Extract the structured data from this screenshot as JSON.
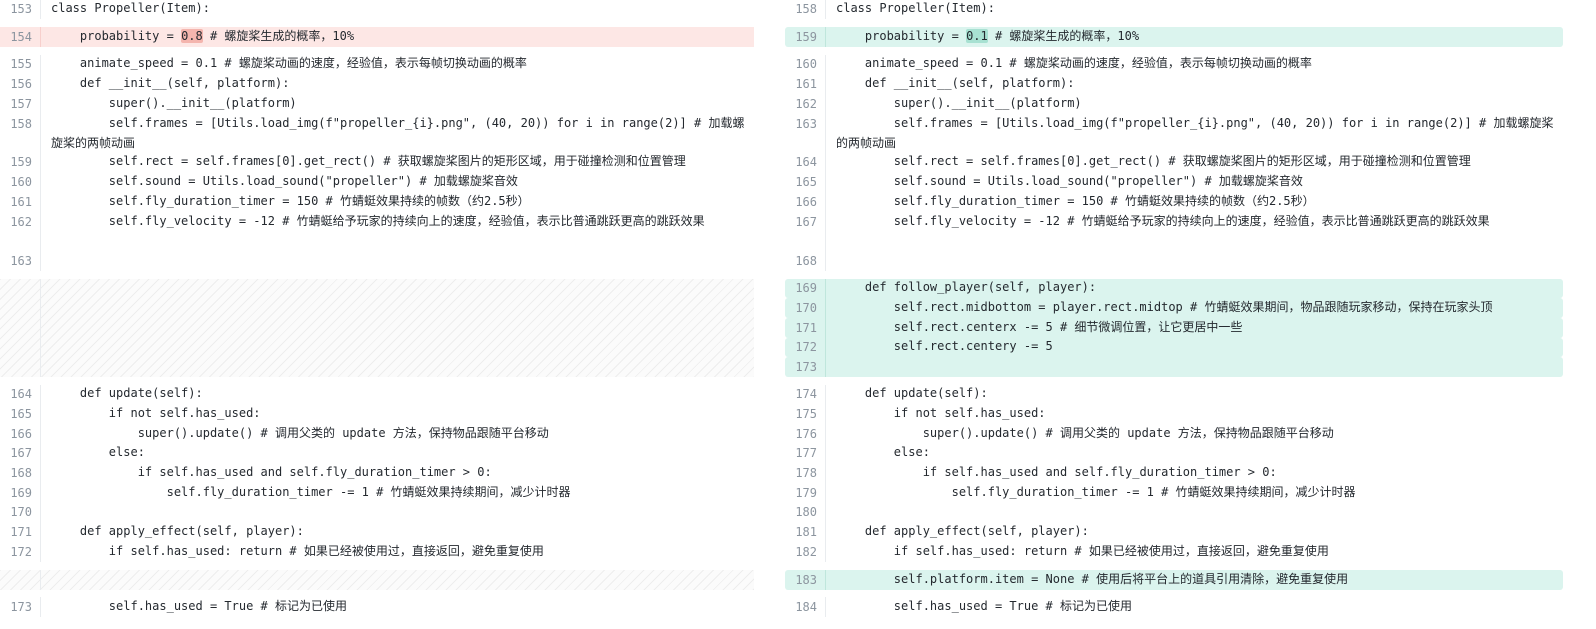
{
  "left": {
    "rows": [
      {
        "num": "153",
        "text": "class Propeller(Item):"
      },
      {
        "num": "154",
        "pre": "    probability = ",
        "mark": "0.8",
        "post": " # 螺旋桨生成的概率，10%"
      },
      {
        "num": "155",
        "text": "    animate_speed = 0.1 # 螺旋桨动画的速度，经验值，表示每帧切换动画的概率"
      },
      {
        "num": "156",
        "text": "    def __init__(self, platform):"
      },
      {
        "num": "157",
        "text": "        super().__init__(platform)"
      },
      {
        "num": "158",
        "text": "        self.frames = [Utils.load_img(f\"propeller_{i}.png\", (40, 20)) for i in range(2)] # 加载螺旋桨的两帧动画"
      },
      {
        "num": "159",
        "text": "        self.rect = self.frames[0].get_rect() # 获取螺旋桨图片的矩形区域，用于碰撞检测和位置管理"
      },
      {
        "num": "160",
        "text": "        self.sound = Utils.load_sound(\"propeller\") # 加载螺旋桨音效"
      },
      {
        "num": "161",
        "text": "        self.fly_duration_timer = 150 # 竹蜻蜓效果持续的帧数（约2.5秒）"
      },
      {
        "num": "162",
        "text": "        self.fly_velocity = -12 # 竹蜻蜓给予玩家的持续向上的速度，经验值，表示比普通跳跃更高的跳跃效果"
      },
      {
        "num": "163",
        "text": ""
      },
      {
        "num": "164",
        "text": "    def update(self):"
      },
      {
        "num": "165",
        "text": "        if not self.has_used:"
      },
      {
        "num": "166",
        "text": "            super().update() # 调用父类的 update 方法，保持物品跟随平台移动"
      },
      {
        "num": "167",
        "text": "        else:"
      },
      {
        "num": "168",
        "text": "            if self.has_used and self.fly_duration_timer > 0:"
      },
      {
        "num": "169",
        "text": "                self.fly_duration_timer -= 1 # 竹蜻蜓效果持续期间，减少计时器"
      },
      {
        "num": "170",
        "text": ""
      },
      {
        "num": "171",
        "text": "    def apply_effect(self, player):"
      },
      {
        "num": "172",
        "text": "        if self.has_used: return # 如果已经被使用过，直接返回，避免重复使用"
      },
      {
        "num": "173",
        "text": "        self.has_used = True # 标记为已使用"
      }
    ]
  },
  "right": {
    "rows": [
      {
        "num": "158",
        "text": "class Propeller(Item):"
      },
      {
        "num": "159",
        "pre": "    probability = ",
        "mark": "0.1",
        "post": " # 螺旋桨生成的概率，10%"
      },
      {
        "num": "160",
        "text": "    animate_speed = 0.1 # 螺旋桨动画的速度，经验值，表示每帧切换动画的概率"
      },
      {
        "num": "161",
        "text": "    def __init__(self, platform):"
      },
      {
        "num": "162",
        "text": "        super().__init__(platform)"
      },
      {
        "num": "163",
        "text": "        self.frames = [Utils.load_img(f\"propeller_{i}.png\", (40, 20)) for i in range(2)] # 加载螺旋桨的两帧动画"
      },
      {
        "num": "164",
        "text": "        self.rect = self.frames[0].get_rect() # 获取螺旋桨图片的矩形区域，用于碰撞检测和位置管理"
      },
      {
        "num": "165",
        "text": "        self.sound = Utils.load_sound(\"propeller\") # 加载螺旋桨音效"
      },
      {
        "num": "166",
        "text": "        self.fly_duration_timer = 150 # 竹蜻蜓效果持续的帧数（约2.5秒）"
      },
      {
        "num": "167",
        "text": "        self.fly_velocity = -12 # 竹蜻蜓给予玩家的持续向上的速度，经验值，表示比普通跳跃更高的跳跃效果"
      },
      {
        "num": "168",
        "text": ""
      },
      {
        "num": "169",
        "text": "    def follow_player(self, player):"
      },
      {
        "num": "170",
        "text": "        self.rect.midbottom = player.rect.midtop # 竹蜻蜓效果期间，物品跟随玩家移动，保持在玩家头顶"
      },
      {
        "num": "171",
        "text": "        self.rect.centerx -= 5 # 细节微调位置，让它更居中一些"
      },
      {
        "num": "172",
        "text": "        self.rect.centery -= 5"
      },
      {
        "num": "173",
        "text": ""
      },
      {
        "num": "174",
        "text": "    def update(self):"
      },
      {
        "num": "175",
        "text": "        if not self.has_used:"
      },
      {
        "num": "176",
        "text": "            super().update() # 调用父类的 update 方法，保持物品跟随平台移动"
      },
      {
        "num": "177",
        "text": "        else:"
      },
      {
        "num": "178",
        "text": "            if self.has_used and self.fly_duration_timer > 0:"
      },
      {
        "num": "179",
        "text": "                self.fly_duration_timer -= 1 # 竹蜻蜓效果持续期间，减少计时器"
      },
      {
        "num": "180",
        "text": ""
      },
      {
        "num": "181",
        "text": "    def apply_effect(self, player):"
      },
      {
        "num": "182",
        "text": "        if self.has_used: return # 如果已经被使用过，直接返回，避免重复使用"
      },
      {
        "num": "183",
        "text": "        self.platform.item = None # 使用后将平台上的道具引用清除，避免重复使用"
      },
      {
        "num": "184",
        "text": "        self.has_used = True # 标记为已使用"
      }
    ]
  },
  "colors": {
    "deleted_line_bg": "#fde7e5",
    "added_line_bg": "#dbf4ee",
    "deleted_word_bg": "#f4b5ae",
    "added_word_bg": "#a8e1d2",
    "line_number": "#8c959f"
  }
}
